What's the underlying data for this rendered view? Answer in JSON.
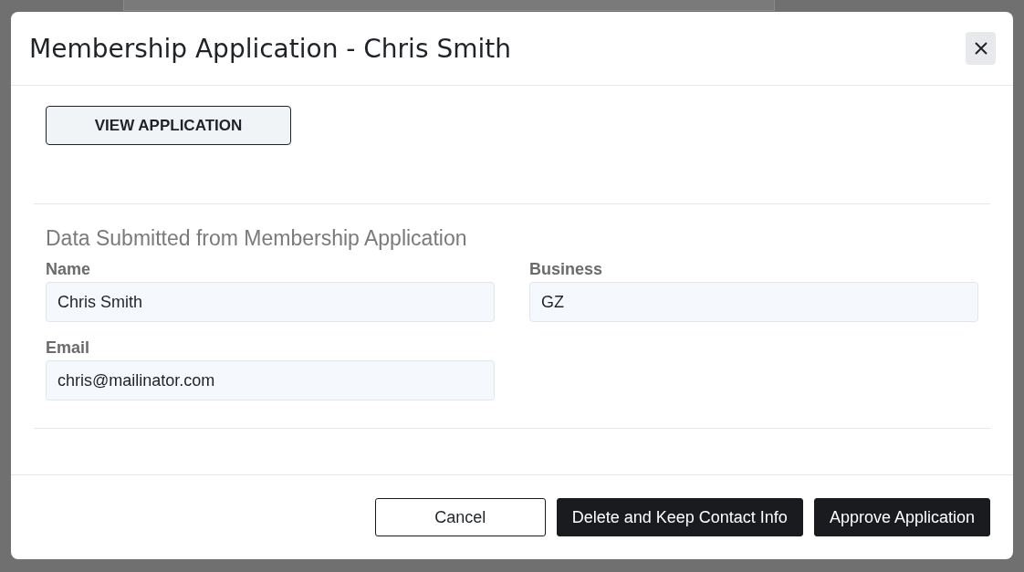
{
  "dialog": {
    "title": "Membership Application - Chris Smith",
    "view_button": "VIEW APPLICATION",
    "section_title": "Data Submitted from Membership Application",
    "fields": [
      {
        "label": "Name",
        "value": "Chris Smith"
      },
      {
        "label": "Business",
        "value": "GZ"
      },
      {
        "label": "Email",
        "value": "chris@mailinator.com"
      }
    ],
    "buttons": [
      {
        "label": "Cancel",
        "kind": "secondary"
      },
      {
        "label": "Delete and Keep Contact Info",
        "kind": "primary"
      },
      {
        "label": "Approve Application",
        "kind": "primary"
      }
    ]
  }
}
